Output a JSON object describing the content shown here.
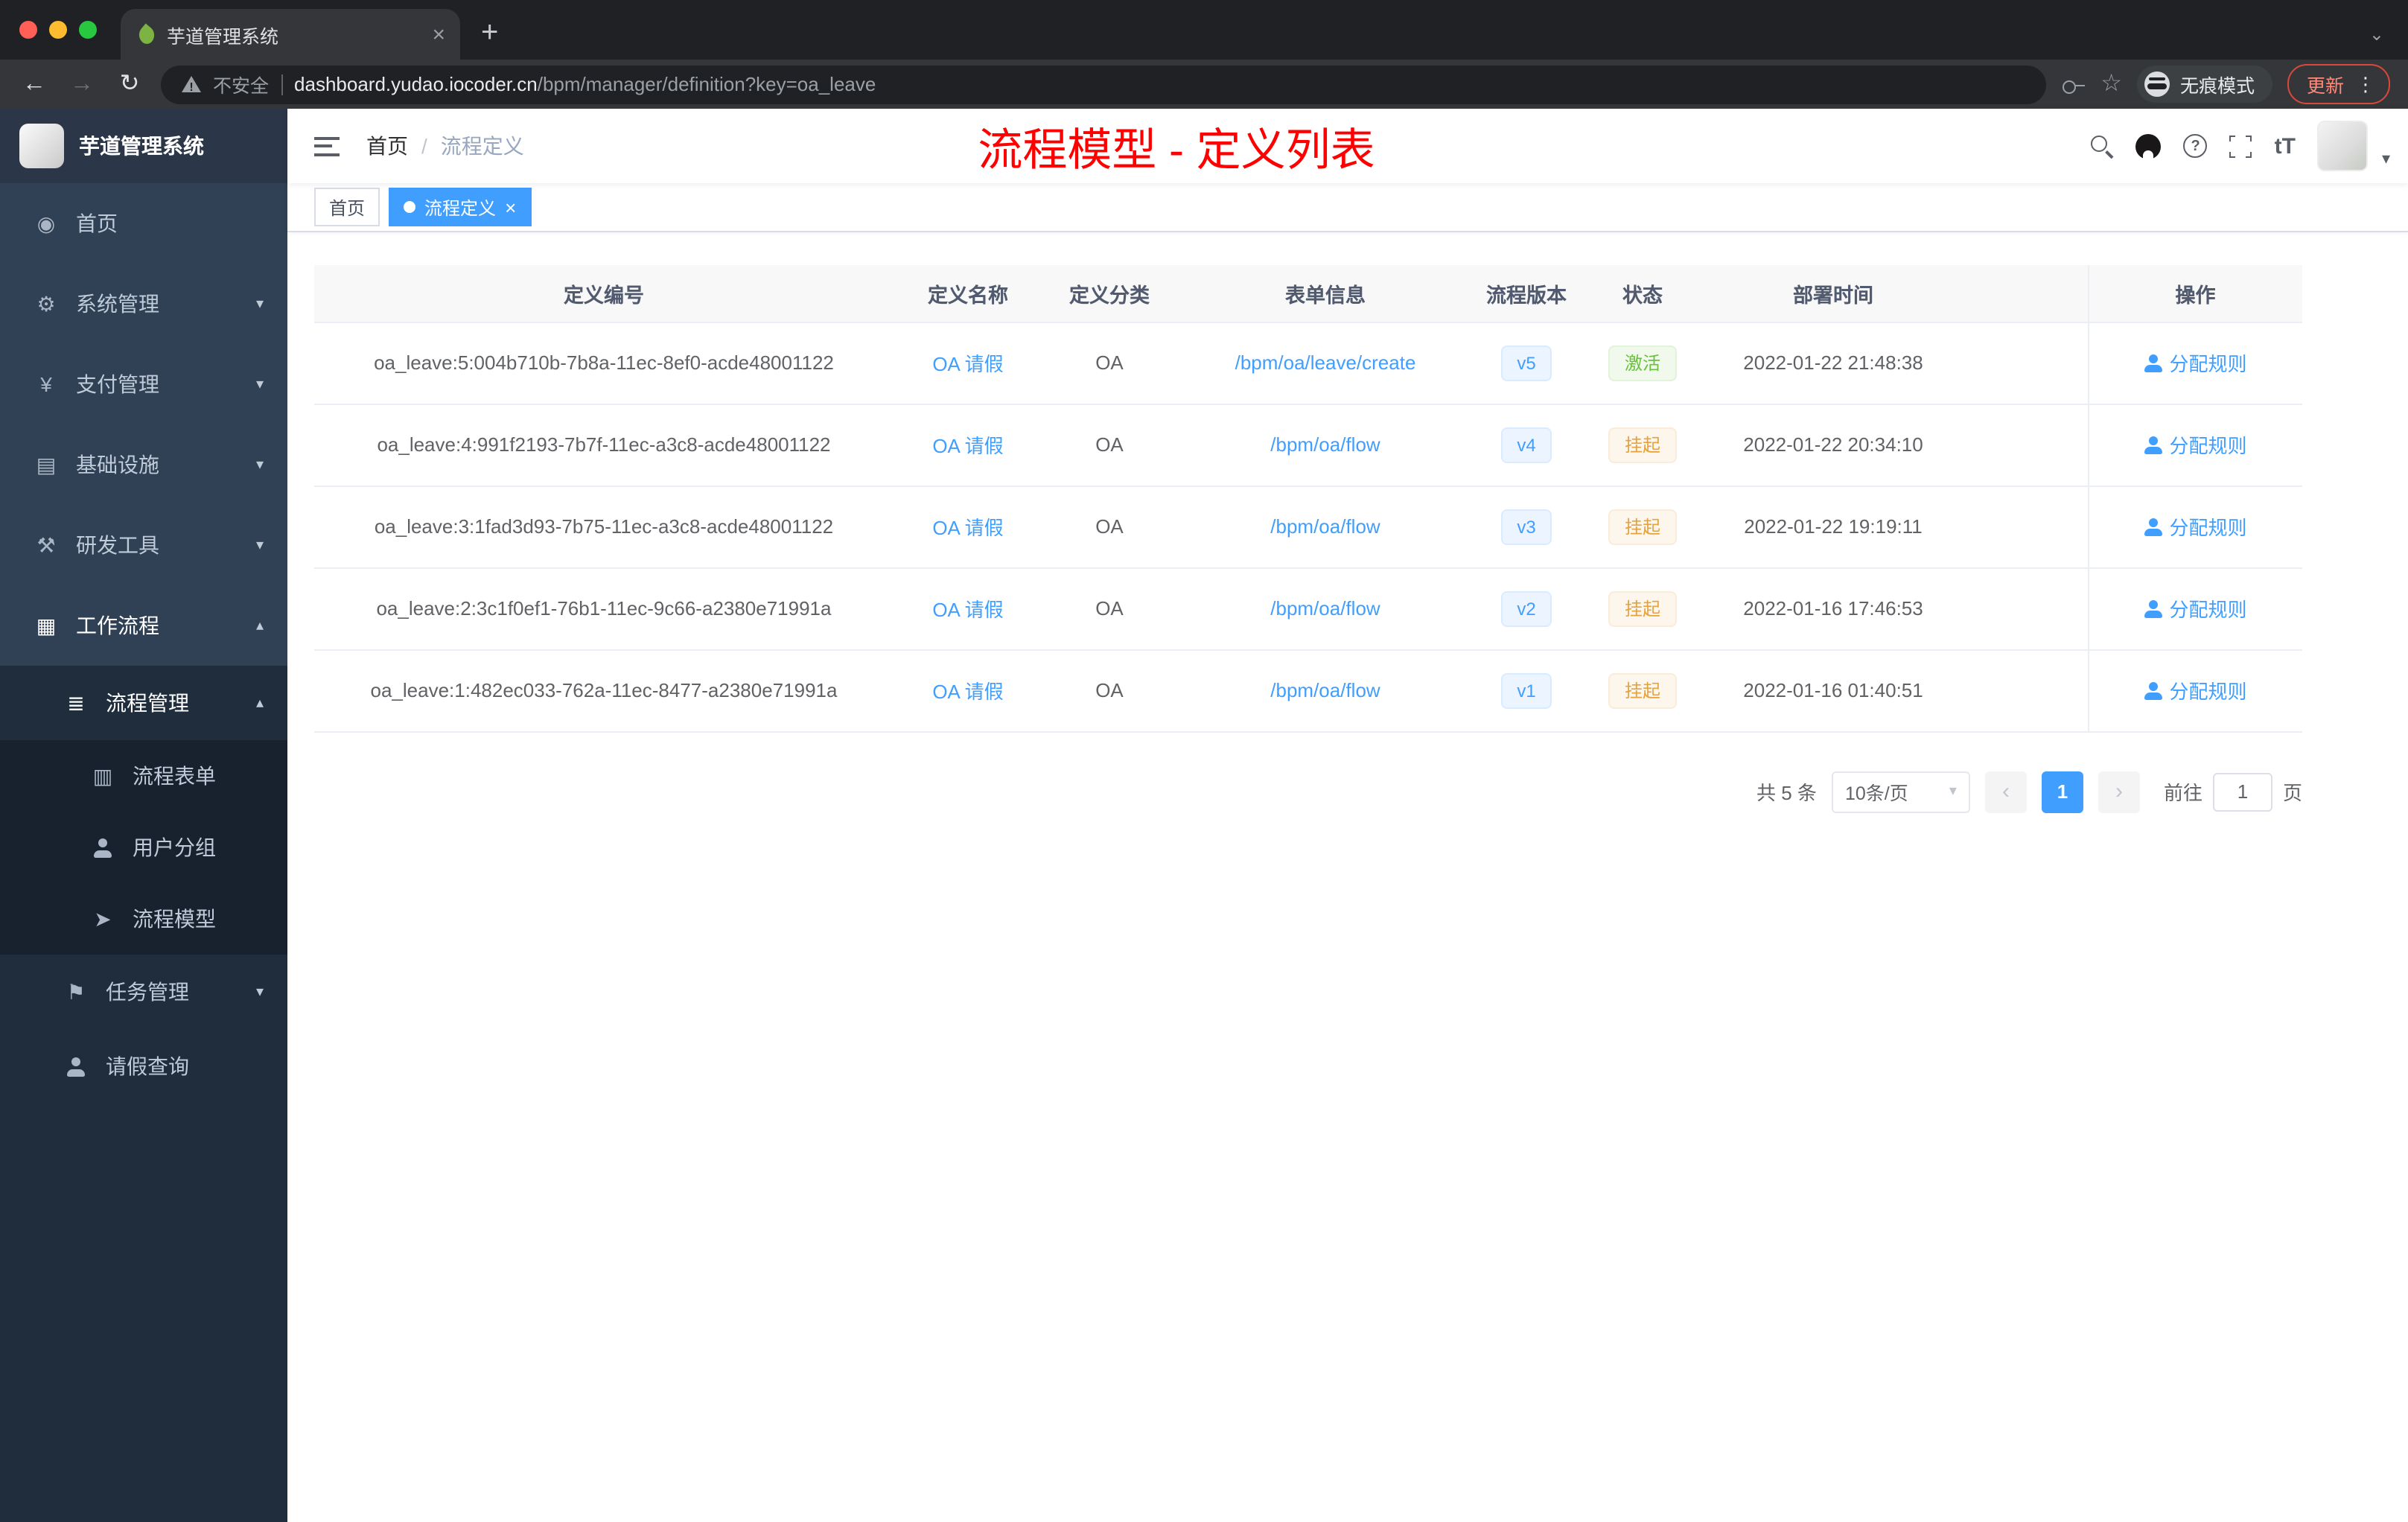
{
  "colors": {
    "accent": "#409eff",
    "success": "#67c23a",
    "warning": "#e6a23c",
    "annotation_red": "#ff0000",
    "sidebar_bg": "#304156",
    "sidebar_submenu_bg": "#1f2d3d"
  },
  "browser": {
    "tab_title": "芋道管理系统",
    "security_label": "不安全",
    "url_domain": "dashboard.yudao.iocoder.cn",
    "url_path": "/bpm/manager/definition?key=oa_leave",
    "incognito_label": "无痕模式",
    "update_label": "更新"
  },
  "sidebar": {
    "app_title": "芋道管理系统",
    "items": [
      {
        "key": "home",
        "label": "首页",
        "icon": "dashboard-icon",
        "glyph": "◉",
        "level": 1
      },
      {
        "key": "system-manage",
        "label": "系统管理",
        "icon": "gear-icon",
        "glyph": "⚙",
        "level": 1,
        "arrow": "down"
      },
      {
        "key": "payment-manage",
        "label": "支付管理",
        "icon": "yen-icon",
        "glyph": "¥",
        "level": 1,
        "arrow": "down"
      },
      {
        "key": "infrastructure",
        "label": "基础设施",
        "icon": "infrastructure-icon",
        "glyph": "▤",
        "level": 1,
        "arrow": "down"
      },
      {
        "key": "dev-tools",
        "label": "研发工具",
        "icon": "tools-icon",
        "glyph": "⚒",
        "level": 1,
        "arrow": "down"
      },
      {
        "key": "workflow",
        "label": "工作流程",
        "icon": "workflow-icon",
        "glyph": "▦",
        "level": 1,
        "arrow": "up",
        "active": true
      },
      {
        "key": "process-manage",
        "label": "流程管理",
        "icon": "process-list-icon",
        "glyph": "≣",
        "level": 2,
        "arrow": "up",
        "active": true
      },
      {
        "key": "process-form",
        "label": "流程表单",
        "icon": "form-icon",
        "glyph": "▥",
        "level": 3
      },
      {
        "key": "user-group",
        "label": "用户分组",
        "icon": "user-group-icon",
        "glyph": "person",
        "level": 3
      },
      {
        "key": "process-model",
        "label": "流程模型",
        "icon": "paper-plane-icon",
        "glyph": "➤",
        "level": 3
      },
      {
        "key": "task-manage",
        "label": "任务管理",
        "icon": "task-icon",
        "glyph": "⚑",
        "level": 2,
        "arrow": "down"
      },
      {
        "key": "leave-query",
        "label": "请假查询",
        "icon": "user-icon",
        "glyph": "person",
        "level": 2
      }
    ]
  },
  "header": {
    "breadcrumb": [
      "首页",
      "流程定义"
    ],
    "annotation": "流程模型 - 定义列表",
    "font_size_icon_glyph": "tT"
  },
  "tags": [
    {
      "label": "首页",
      "active": false
    },
    {
      "label": "流程定义",
      "active": true
    }
  ],
  "table": {
    "columns": [
      "定义编号",
      "定义名称",
      "定义分类",
      "表单信息",
      "流程版本",
      "状态",
      "部署时间",
      "操作"
    ],
    "rows": [
      {
        "id": "oa_leave:5:004b710b-7b8a-11ec-8ef0-acde48001122",
        "name": "OA 请假",
        "category": "OA",
        "form": "/bpm/oa/leave/create",
        "version": "v5",
        "status": "激活",
        "status_type": "success",
        "time": "2022-01-22 21:48:38",
        "action": "分配规则"
      },
      {
        "id": "oa_leave:4:991f2193-7b7f-11ec-a3c8-acde48001122",
        "name": "OA 请假",
        "category": "OA",
        "form": "/bpm/oa/flow",
        "version": "v4",
        "status": "挂起",
        "status_type": "warning",
        "time": "2022-01-22 20:34:10",
        "action": "分配规则"
      },
      {
        "id": "oa_leave:3:1fad3d93-7b75-11ec-a3c8-acde48001122",
        "name": "OA 请假",
        "category": "OA",
        "form": "/bpm/oa/flow",
        "version": "v3",
        "status": "挂起",
        "status_type": "warning",
        "time": "2022-01-22 19:19:11",
        "action": "分配规则"
      },
      {
        "id": "oa_leave:2:3c1f0ef1-76b1-11ec-9c66-a2380e71991a",
        "name": "OA 请假",
        "category": "OA",
        "form": "/bpm/oa/flow",
        "version": "v2",
        "status": "挂起",
        "status_type": "warning",
        "time": "2022-01-16 17:46:53",
        "action": "分配规则"
      },
      {
        "id": "oa_leave:1:482ec033-762a-11ec-8477-a2380e71991a",
        "name": "OA 请假",
        "category": "OA",
        "form": "/bpm/oa/flow",
        "version": "v1",
        "status": "挂起",
        "status_type": "warning",
        "time": "2022-01-16 01:40:51",
        "action": "分配规则"
      }
    ]
  },
  "pagination": {
    "total": "共 5 条",
    "page_size": "10条/页",
    "current_page": "1",
    "goto_label": "前往",
    "goto_value": "1",
    "page_unit": "页"
  }
}
